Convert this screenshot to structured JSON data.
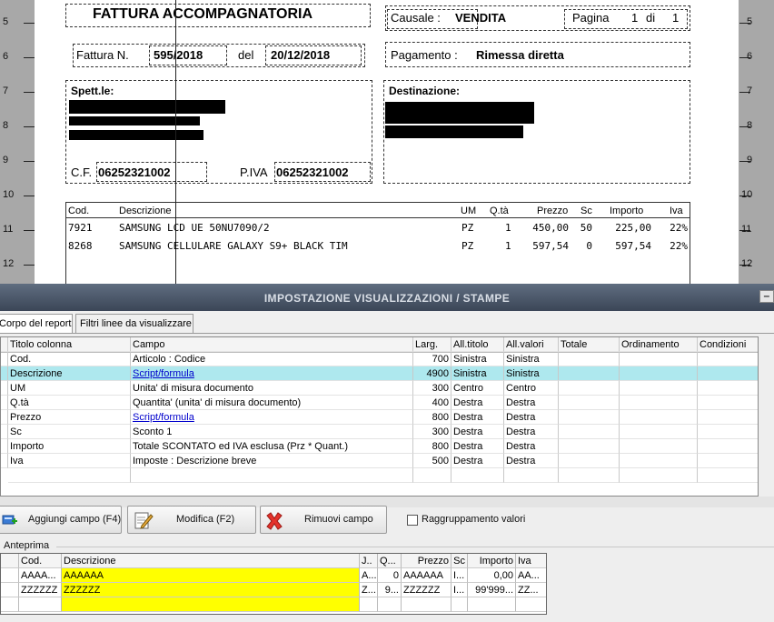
{
  "report": {
    "ruler_numbers": [
      "5",
      "6",
      "7",
      "8",
      "9",
      "10",
      "11",
      "12"
    ],
    "doc_title": "FATTURA ACCOMPAGNATORIA",
    "causale_label": "Causale :",
    "causale_value": "VENDITA",
    "pagina_label": "Pagina",
    "pagina_num": "1",
    "pagina_di": "di",
    "pagina_tot": "1",
    "fattura_label": "Fattura N.",
    "fattura_num": "595/2018",
    "del_label": "del",
    "fattura_date": "20/12/2018",
    "pagamento_label": "Pagamento :",
    "pagamento_value": "Rimessa diretta",
    "spett_label": "Spett.le:",
    "destinazione_label": "Destinazione:",
    "cf_label": "C.F.",
    "cf_value": "06252321002",
    "piva_label": "P.IVA",
    "piva_value": "06252321002",
    "columns": {
      "cod": "Cod.",
      "descrizione": "Descrizione",
      "um": "UM",
      "qta": "Q.tà",
      "prezzo": "Prezzo",
      "sc": "Sc",
      "importo": "Importo",
      "iva": "Iva"
    },
    "lines": [
      {
        "cod": "7921",
        "descrizione": "SAMSUNG LCD UE 50NU7090/2",
        "um": "PZ",
        "qta": "1",
        "prezzo": "450,00",
        "sc": "50",
        "importo": "225,00",
        "iva": "22%"
      },
      {
        "cod": "8268",
        "descrizione": "SAMSUNG CELLULARE GALAXY S9+ BLACK TIM",
        "um": "PZ",
        "qta": "1",
        "prezzo": "597,54",
        "sc": "0",
        "importo": "597,54",
        "iva": "22%"
      }
    ]
  },
  "panel": {
    "title": "IMPOSTAZIONE VISUALIZZAZIONI / STAMPE",
    "minimize_glyph": "–",
    "tabs": [
      "Corpo del report",
      "Filtri linee da visualizzare"
    ],
    "grid": {
      "headers": [
        "Titolo colonna",
        "Campo",
        "Larg.",
        "All.titolo",
        "All.valori",
        "Totale",
        "Ordinamento",
        "Condizioni"
      ],
      "rows": [
        [
          "Cod.",
          "Articolo : Codice",
          "700",
          "Sinistra",
          "Sinistra",
          "",
          "",
          ""
        ],
        [
          "Descrizione",
          "Script/formula",
          "4900",
          "Sinistra",
          "Sinistra",
          "",
          "",
          ""
        ],
        [
          "UM",
          "Unita' di misura documento",
          "300",
          "Centro",
          "Centro",
          "",
          "",
          ""
        ],
        [
          "Q.tà",
          "Quantita' (unita' di misura documento)",
          "400",
          "Destra",
          "Destra",
          "",
          "",
          ""
        ],
        [
          "Prezzo",
          "Script/formula",
          "800",
          "Destra",
          "Destra",
          "",
          "",
          ""
        ],
        [
          "Sc",
          "Sconto 1",
          "300",
          "Destra",
          "Destra",
          "",
          "",
          ""
        ],
        [
          "Importo",
          "Totale SCONTATO ed IVA esclusa (Prz * Quant.)",
          "800",
          "Destra",
          "Destra",
          "",
          "",
          ""
        ],
        [
          "Iva",
          "Imposte : Descrizione breve",
          "500",
          "Destra",
          "Destra",
          "",
          "",
          ""
        ]
      ],
      "selected_row": 1,
      "link_rows": [
        1,
        4
      ]
    },
    "buttons": {
      "add": "Aggiungi campo (F4)",
      "edit": "Modifica (F2)",
      "remove": "Rimuovi campo"
    },
    "grouping_label": "Raggruppamento valori",
    "grouping_checked": false,
    "preview_label": "Anteprima",
    "preview": {
      "headers": [
        "",
        "Cod.",
        "Descrizione",
        "J..",
        "Q...",
        "Prezzo",
        "Sc",
        "Importo",
        "Iva"
      ],
      "rows": [
        [
          "",
          "AAAA...",
          "AAAAAA",
          "A...",
          "0",
          "AAAAAA",
          "I...",
          "0,00",
          "AA..."
        ],
        [
          "",
          "ZZZZZZ",
          "ZZZZZZ",
          "Z...",
          "9...",
          "ZZZZZZ",
          "I...",
          "99'999...",
          "ZZ..."
        ],
        [
          "",
          "",
          "",
          "",
          "",
          "",
          "",
          "",
          ""
        ]
      ]
    }
  },
  "colors": {
    "selected_row": "#aee8ee",
    "preview_highlight": "#ffff00",
    "title_bar": "#3b4657",
    "link": "#0000cc"
  }
}
